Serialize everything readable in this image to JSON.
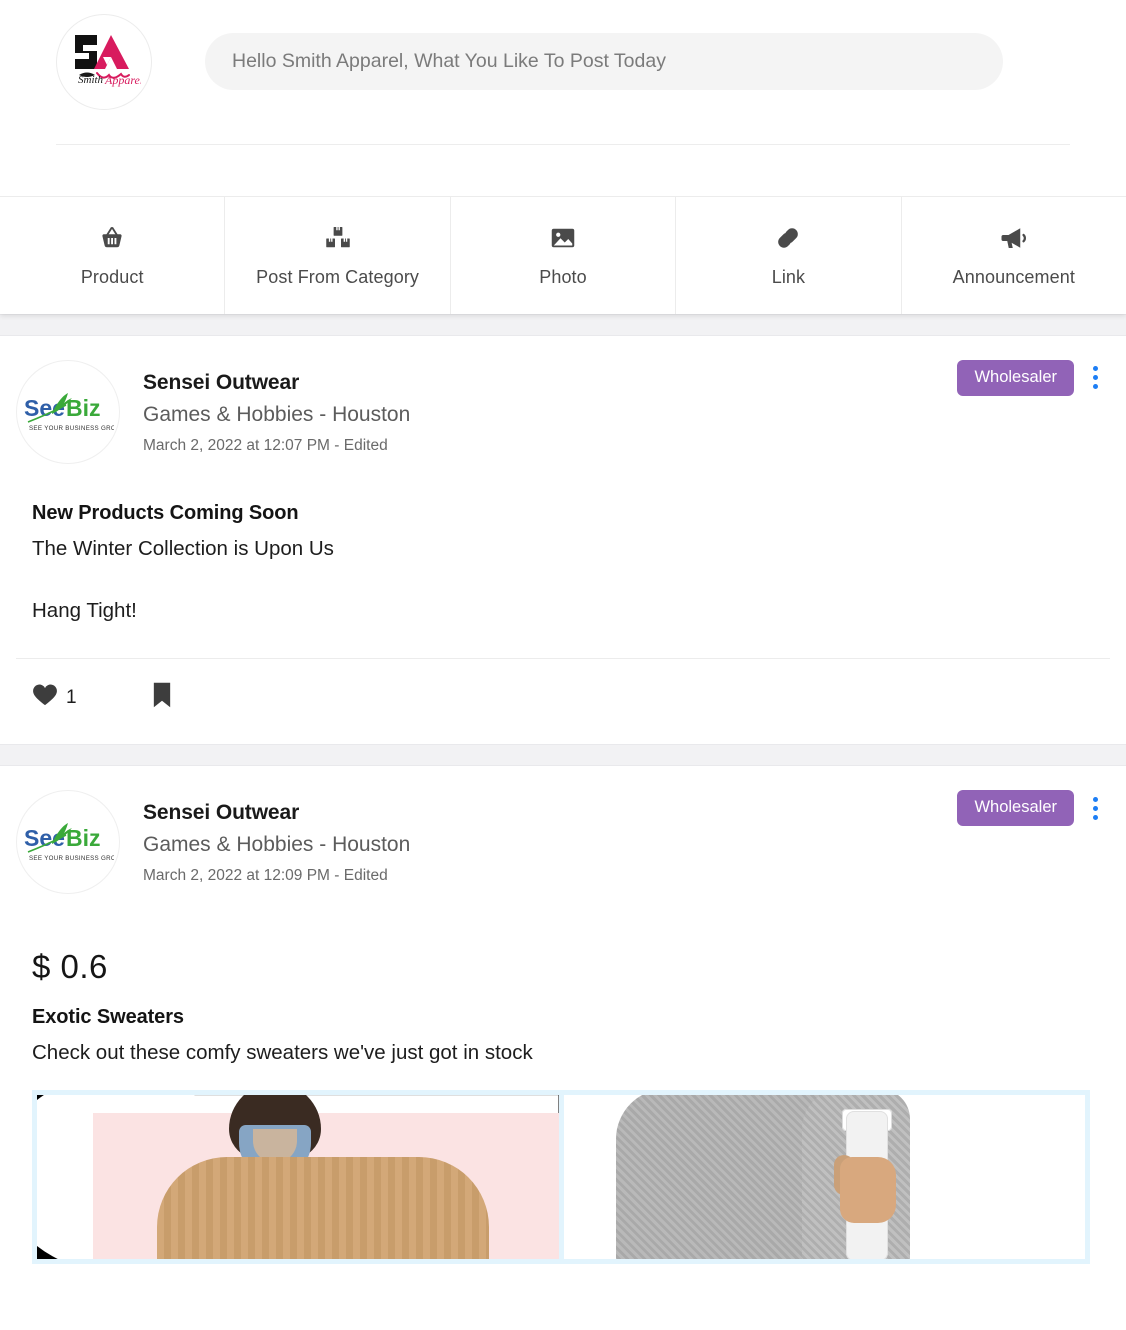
{
  "composer": {
    "avatar_alt": "Smith Apparel",
    "avatar_initials": "SA",
    "avatar_tagline": "Smith Apparel",
    "input_placeholder": "Hello Smith Apparel, What You Like To Post Today",
    "input_value": "",
    "actions": [
      {
        "label": "Product",
        "icon": "basket-icon"
      },
      {
        "label": "Post From Category",
        "icon": "boxes-icon"
      },
      {
        "label": "Photo",
        "icon": "image-icon"
      },
      {
        "label": "Link",
        "icon": "link-icon"
      },
      {
        "label": "Announcement",
        "icon": "megaphone-icon"
      }
    ]
  },
  "colors": {
    "badge_purple": "#9163b7",
    "kebab_blue": "#1d7ef5",
    "gallery_frame": "#e2f4fd",
    "page_gap": "#f2f2f4",
    "logo_blue": "#2f5fa8",
    "logo_green": "#3aa93a"
  },
  "posts": [
    {
      "avatar_alt": "SeeBiz",
      "avatar_word_1": "See",
      "avatar_word_2": "Biz",
      "avatar_tagline": "SEE YOUR BUSINESS GROW",
      "author": "Sensei Outwear",
      "subtitle": "Games & Hobbies - Houston",
      "timestamp": "March 2, 2022 at 12:07 PM - Edited",
      "badge": "Wholesaler",
      "menu_icon": "kebab-menu-icon",
      "title": "New Products Coming Soon",
      "text_1": "The Winter Collection is Upon Us",
      "text_2": "Hang Tight!",
      "like_icon": "heart-icon",
      "like_count": "1",
      "bookmark_icon": "bookmark-icon"
    },
    {
      "avatar_alt": "SeeBiz",
      "avatar_word_1": "See",
      "avatar_word_2": "Biz",
      "avatar_tagline": "SEE YOUR BUSINESS GROW",
      "author": "Sensei Outwear",
      "subtitle": "Games & Hobbies - Houston",
      "timestamp": "March 2, 2022 at 12:09 PM - Edited",
      "badge": "Wholesaler",
      "menu_icon": "kebab-menu-icon",
      "price": "$ 0.6",
      "title": "Exotic Sweaters",
      "text_1": "Check out these comfy sweaters we've just got in stock",
      "gallery": [
        {
          "alt": "tan cable knit sweater on model"
        },
        {
          "alt": "gray knit sweater with coffee cup"
        }
      ]
    }
  ]
}
